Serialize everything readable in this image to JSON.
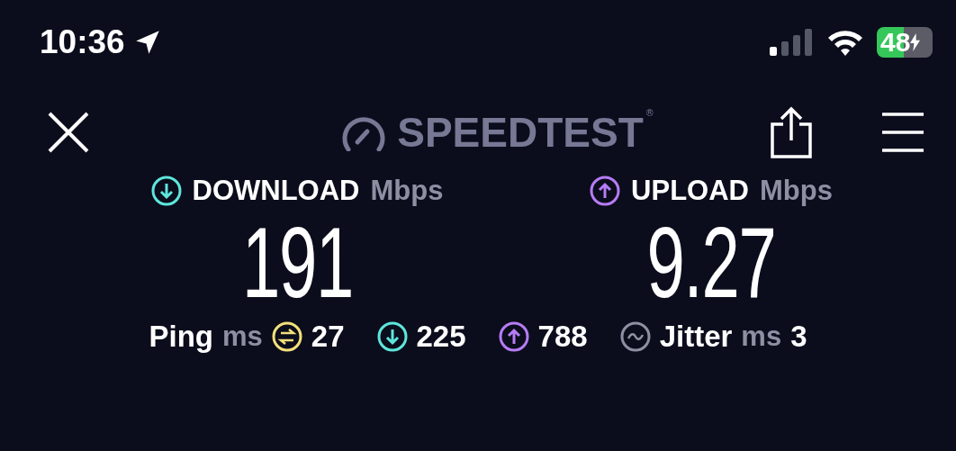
{
  "status_bar": {
    "time": "10:36",
    "battery": "48"
  },
  "header": {
    "logo": "SPEEDTEST",
    "registered": "®"
  },
  "metrics": [
    {
      "kind": "download",
      "label": "DOWNLOAD",
      "unit": "Mbps",
      "value": "191",
      "color": "#5ee6dc"
    },
    {
      "kind": "upload",
      "label": "UPLOAD",
      "unit": "Mbps",
      "value": "9.27",
      "color": "#b77cf5"
    }
  ],
  "stats": [
    {
      "kind": "ping",
      "label": "Ping",
      "unit": "ms",
      "color": "#f3e07a",
      "value": "27"
    },
    {
      "kind": "download",
      "color": "#5ee6dc",
      "value": "225"
    },
    {
      "kind": "upload",
      "color": "#b77cf5",
      "value": "788"
    },
    {
      "kind": "jitter",
      "label": "Jitter",
      "unit": "ms",
      "color": "#8e8fa3",
      "value": "3"
    }
  ]
}
